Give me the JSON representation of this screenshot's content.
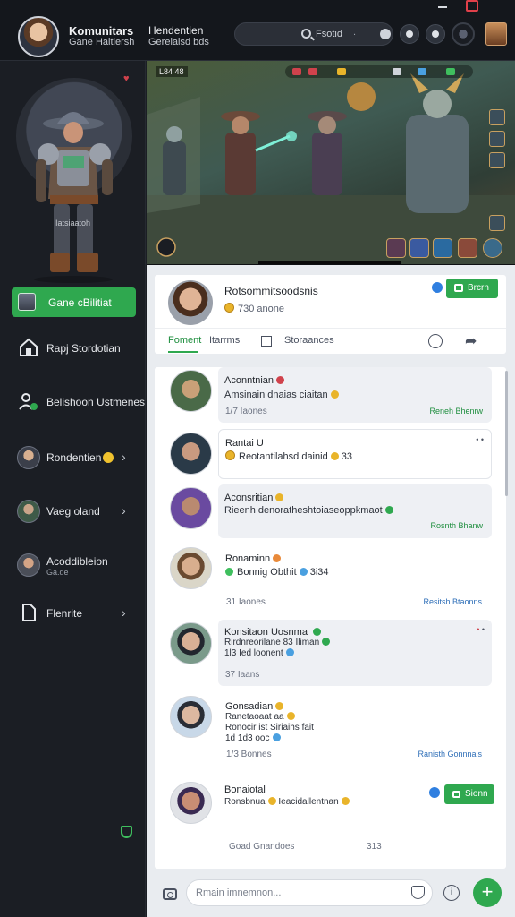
{
  "topbar": {
    "brand_title": "Komunitars",
    "brand_sub": "Gane Haltiersh",
    "brand2_title": "Hendentien",
    "brand2_sub": "Gerelaisd bds",
    "search_value": "Fsotid",
    "search_suffix": "."
  },
  "sidebar": {
    "hero_caption": "Iatsiaatoh",
    "cta_label": "Gane cBilitiat",
    "items": [
      {
        "label": "Rapj Stordotian"
      },
      {
        "label": "Belishoon Ustmenes"
      },
      {
        "label": "Rondentien"
      },
      {
        "label": "Vaeg oland"
      },
      {
        "label": "Acoddibleion",
        "sub": "Ga.de"
      },
      {
        "label": "Flenrite"
      }
    ]
  },
  "game": {
    "tag": "L84 48"
  },
  "profile": {
    "name": "Rotsommitsoodsnis",
    "meta": "730 anone",
    "follow_label": "Brcrn",
    "tabs": [
      "Foment",
      "Itarrms",
      "Storaances"
    ]
  },
  "feed": {
    "posts": [
      {
        "name": "Aconntnian",
        "text": "Amsinain dnaias ciaitan",
        "time": "1/7 Iaones",
        "action": "Reneh Bhenrw"
      },
      {
        "name": "Rantai U",
        "text": "Reotantilahsd dainid",
        "extra": "33",
        "time": "",
        "action": ""
      },
      {
        "name": "Aconsritian",
        "text": "Rieenh denoratheshtoiaseoppkmaot",
        "time": "",
        "action": "Rosnth Bhanw"
      },
      {
        "name": "Ronaminn",
        "text": "Bonnig Obthit",
        "extra": "3i34",
        "time": "31 Iaones",
        "action": "Resitsh Btaonns"
      },
      {
        "name": "Konsitaon Uosnma",
        "text": "Rirdnreorilane 83 Iliman",
        "text2": "1l3 Ied loonent",
        "time": "37 Iaans",
        "action": ""
      },
      {
        "name": "Gonsadian",
        "text": "Ranetaoaat aa",
        "text2": "Ronocir ist Siriaihs fait",
        "text3": "1d 1d3 ooc",
        "time": "1/3 Bonnes",
        "action": "Ranisth Gonnnais"
      },
      {
        "name": "Bonaiotal",
        "text": "Ronsbnua",
        "text2": "Ieacidallentnan",
        "time": "Goad Gnandoes",
        "time2": "313",
        "follow_label": "Sionn"
      }
    ]
  },
  "compose": {
    "placeholder": "Rmain imnemnon..."
  }
}
